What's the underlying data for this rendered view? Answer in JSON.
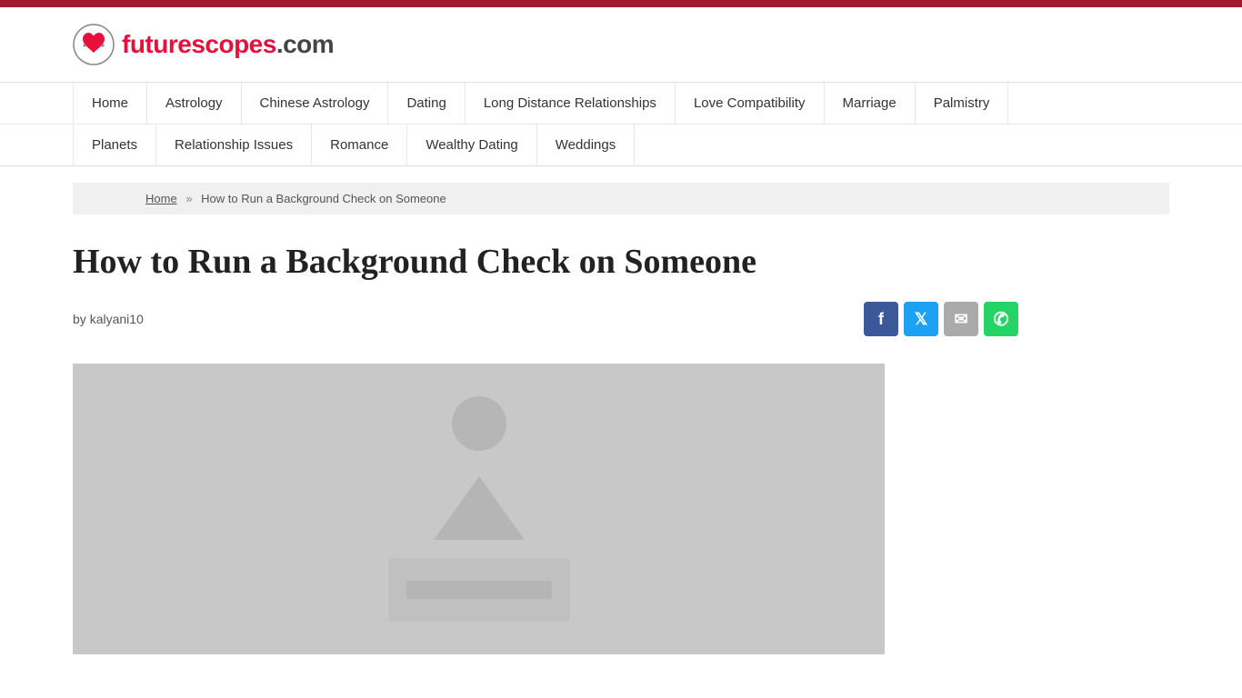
{
  "site": {
    "top_bar_color": "#a0192e",
    "logo_text": "futurescopes.com",
    "logo_text_colored": "futurescopes",
    "logo_text_suffix": ".com"
  },
  "nav": {
    "row1": [
      {
        "label": "Home",
        "id": "home"
      },
      {
        "label": "Astrology",
        "id": "astrology"
      },
      {
        "label": "Chinese Astrology",
        "id": "chinese-astrology"
      },
      {
        "label": "Dating",
        "id": "dating"
      },
      {
        "label": "Long Distance Relationships",
        "id": "long-distance"
      },
      {
        "label": "Love Compatibility",
        "id": "love-compatibility"
      },
      {
        "label": "Marriage",
        "id": "marriage"
      },
      {
        "label": "Palmistry",
        "id": "palmistry"
      }
    ],
    "row2": [
      {
        "label": "Planets",
        "id": "planets"
      },
      {
        "label": "Relationship Issues",
        "id": "relationship-issues"
      },
      {
        "label": "Romance",
        "id": "romance"
      },
      {
        "label": "Wealthy Dating",
        "id": "wealthy-dating"
      },
      {
        "label": "Weddings",
        "id": "weddings"
      }
    ]
  },
  "breadcrumb": {
    "home_label": "Home",
    "separator": "»",
    "current": "How to Run a Background Check on Someone"
  },
  "article": {
    "title": "How to Run a Background Check on Someone",
    "author_prefix": "by",
    "author": "kalyani10"
  },
  "social": {
    "facebook_label": "f",
    "twitter_label": "t",
    "email_label": "✉",
    "whatsapp_label": "w"
  }
}
